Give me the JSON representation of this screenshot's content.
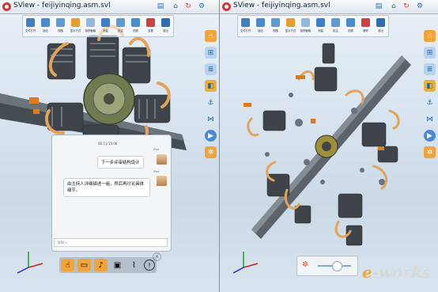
{
  "panels": [
    {
      "title": "SView - feijiyinqing.asm.svl",
      "toolbar": [
        "文件打开",
        "适应",
        "视图",
        "显示方式",
        "剖视截取",
        "测量",
        "批注",
        "拍照",
        "查看",
        "退出"
      ],
      "chat": {
        "timestamp": "06-13 15:08",
        "messages": [
          {
            "user": "iPad",
            "text": "下一步评审结构设计"
          },
          {
            "user": "iPad",
            "text": "由主持人详细描述一遍，然后再讨论具体细节。"
          }
        ],
        "input_placeholder": "请输入"
      }
    },
    {
      "title": "SView - feijiyinqing.asm.svl",
      "toolbar": [
        "文件打开",
        "适应",
        "视图",
        "显示方式",
        "剖视截取",
        "测量",
        "批注",
        "拍照",
        "爆炸",
        "退出"
      ],
      "explode_level": 0.55
    }
  ],
  "watermark": {
    "prefix": "e",
    "suffix": "-works"
  },
  "colors": {
    "accent": "#f0a43a",
    "toolbar_icon": "#2c6fb5",
    "logo": "#d33333"
  },
  "icons": {
    "title_right": [
      "folder-icon",
      "home-icon",
      "refresh-icon",
      "settings-icon"
    ],
    "side": [
      "hand-icon",
      "axis-icon",
      "layers-icon",
      "cube-icon",
      "anchor-icon",
      "share-icon",
      "play-icon",
      "explode-icon"
    ],
    "bottom": [
      "gesture-icon",
      "chat-icon",
      "microphone-icon",
      "camera-icon",
      "attachment-icon",
      "info-icon"
    ]
  }
}
